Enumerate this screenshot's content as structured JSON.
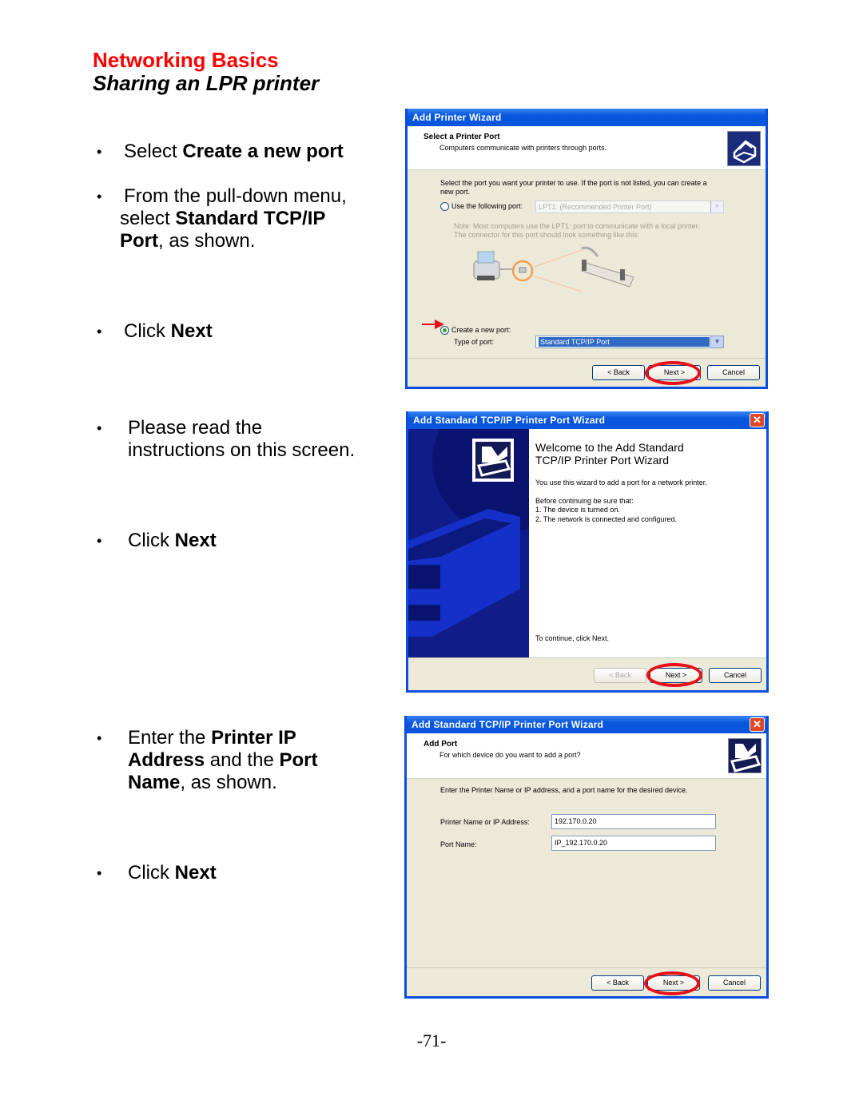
{
  "header": {
    "section_title": "Networking Basics",
    "subtitle": "Sharing an LPR printer"
  },
  "instructions": [
    {
      "pre": "Select ",
      "bold": "Create a new port",
      "post": ""
    },
    {
      "pre": "From the pull-down menu,",
      "line2_pre": "select ",
      "line2_bold": "Standard TCP/IP",
      "line3_bold": "Port",
      "line3_post": ", as shown."
    },
    {
      "pre": "Click ",
      "bold": "Next"
    },
    {
      "pre": "Please read the",
      "line2": "instructions on this screen."
    },
    {
      "pre": "Click ",
      "bold": "Next"
    },
    {
      "pre": "Enter the ",
      "bold": "Printer IP",
      "line2_bold": "Address",
      "line2_mid": " and the ",
      "line2_bold2": "Port",
      "line3_bold": "Name",
      "line3_post": ", as shown."
    },
    {
      "pre": "Click ",
      "bold": "Next"
    }
  ],
  "wizard1": {
    "title": "Add Printer Wizard",
    "heading": "Select a Printer Port",
    "subheading": "Computers communicate with printers through ports.",
    "intro_line1": "Select the port you want your printer to use.  If the port is not listed, you can create a",
    "intro_line2": "new port.",
    "use_port_label": "Use the following port:",
    "use_port_value": "LPT1: (Recommended Printer Port)",
    "note_line1": "Note: Most computers use the LPT1: port to communicate with a local printer.",
    "note_line2": "The connector for this port should look something like this:",
    "create_port_label": "Create a new port:",
    "type_label": "Type of port:",
    "type_value": "Standard TCP/IP Port",
    "back": "< Back",
    "next": "Next >",
    "cancel": "Cancel",
    "selected_option": "create-new-port"
  },
  "wizard2": {
    "title": "Add Standard TCP/IP Printer Port Wizard",
    "welcome_line1": "Welcome to the Add Standard",
    "welcome_line2": "TCP/IP Printer Port Wizard",
    "desc": "You use this wizard to add a port for a network printer.",
    "before": "Before continuing be sure that:",
    "item1": "1.  The device is turned on.",
    "item2": "2.  The network is connected and configured.",
    "continue": "To continue, click Next.",
    "back": "< Back",
    "next": "Next >",
    "cancel": "Cancel",
    "close": "✕"
  },
  "wizard3": {
    "title": "Add Standard TCP/IP Printer Port Wizard",
    "heading": "Add Port",
    "subheading": "For which device do you want to add a port?",
    "intro": "Enter the Printer Name or IP address, and a port name for the desired device.",
    "ip_label": "Printer Name or IP Address:",
    "ip_value": "192.170.0.20",
    "port_label": "Port Name:",
    "port_value": "IP_192.170.0.20",
    "back": "< Back",
    "next": "Next >",
    "cancel": "Cancel",
    "close": "✕"
  },
  "page_number": "-71-"
}
